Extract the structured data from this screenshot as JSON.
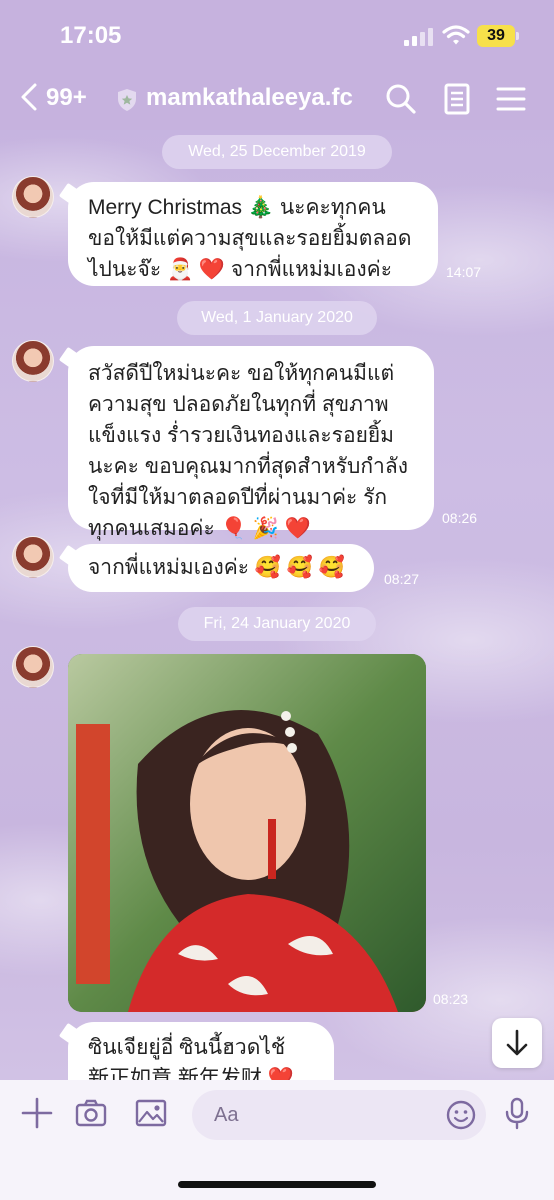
{
  "status": {
    "time": "17:05",
    "battery": "39"
  },
  "header": {
    "back_count": "99+",
    "title": "mamkathaleeya.fc"
  },
  "messages": {
    "date1": "Wed, 25 December 2019",
    "m1_line1": "Merry Christmas 🎄 นะคะทุกคน",
    "m1_line2": "ขอให้มีแต่ความสุขและรอยยิ้มตลอด",
    "m1_line3": "ไปนะจ๊ะ 🎅 ❤️ จากพี่แหม่มเองค่ะ",
    "m1_time": "14:07",
    "date2": "Wed, 1 January 2020",
    "m2_line1": "สวัสดีปีใหม่นะคะ ขอให้ทุกคนมีแต่",
    "m2_line2": "ความสุข ปลอดภัยในทุกที่ สุขภาพ",
    "m2_line3": "แข็งแรง ร่ำรวยเงินทองและรอยยิ้ม",
    "m2_line4": "นะคะ ขอบคุณมากที่สุดสำหรับกำลัง",
    "m2_line5": "ใจที่มีให้มาตลอดปีที่ผ่านมาค่ะ รัก",
    "m2_line6": "ทุกคนเสมอค่ะ 🎈 🎉 ❤️",
    "m2_time": "08:26",
    "m3_text": "จากพี่แหม่มเองค่ะ 🥰 🥰 🥰",
    "m3_time": "08:27",
    "date3": "Fri, 24 January 2020",
    "m4_time": "08:23",
    "m5_line1": "ซินเจียยู่อี่ ซินนี้ฮวดไช้",
    "m5_line2": "新正如意 新年发财 ❤️"
  },
  "composer": {
    "placeholder": "Aa"
  },
  "colors": {
    "header_bg": "#c6b2de",
    "bubble_bg": "#ffffff",
    "battery": "#f7e04a"
  }
}
